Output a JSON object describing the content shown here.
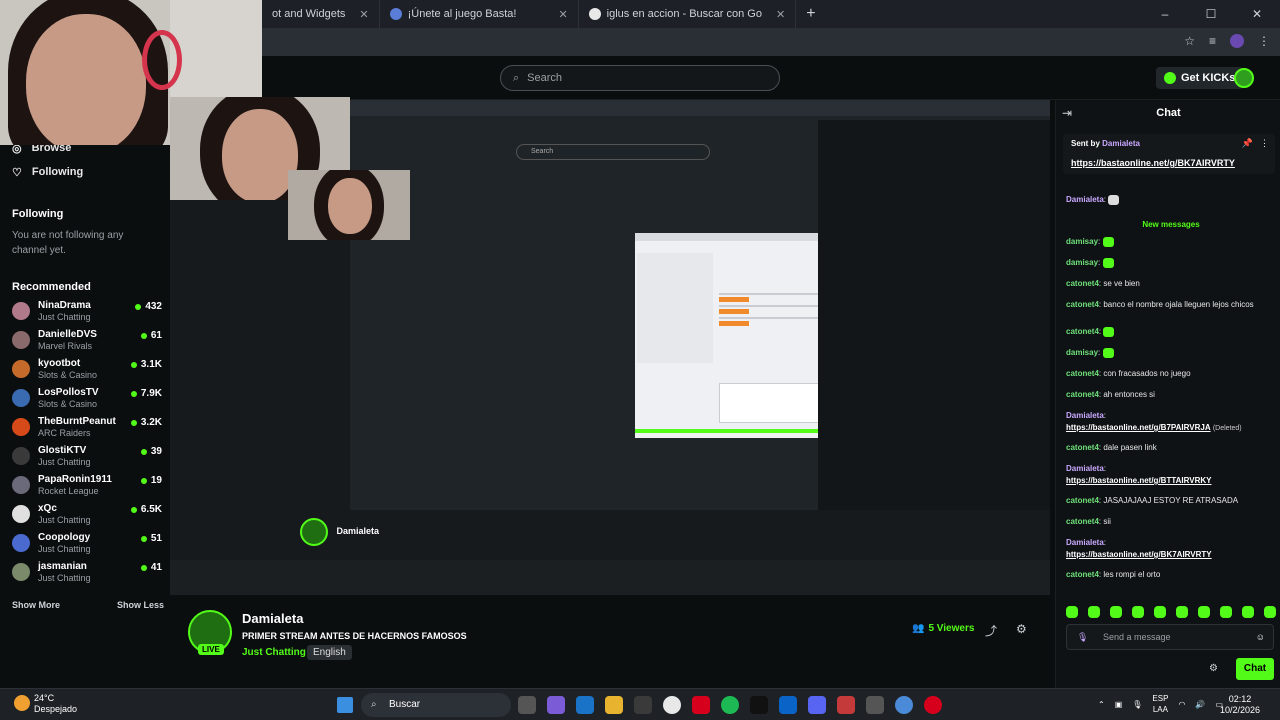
{
  "browser": {
    "tabs": [
      {
        "label": "ot and Widgets"
      },
      {
        "label": "¡Únete al juego Basta!"
      },
      {
        "label": "iglus en accion - Buscar con Go"
      }
    ],
    "new_tab": "+",
    "window_buttons": [
      "–",
      "☐",
      "✕"
    ]
  },
  "header": {
    "search_placeholder": "Search",
    "get_kicks_label": "Get KICKs"
  },
  "sidebar": {
    "browse_label": "Browse",
    "following_nav": "Following",
    "following_heading": "Following",
    "following_note": "You are not following any channel yet.",
    "recommended_heading": "Recommended",
    "channels": [
      {
        "name": "NinaDrama",
        "category": "Just Chatting",
        "viewers": "432",
        "color": "#b07a8a"
      },
      {
        "name": "DanielleDVS",
        "category": "Marvel Rivals",
        "viewers": "61",
        "color": "#8a6a6a"
      },
      {
        "name": "kyootbot",
        "category": "Slots & Casino",
        "viewers": "3.1K",
        "color": "#c46a2a"
      },
      {
        "name": "LosPollosTV",
        "category": "Slots & Casino",
        "viewers": "7.9K",
        "color": "#3a6ab0"
      },
      {
        "name": "TheBurntPeanut",
        "category": "ARC Raiders",
        "viewers": "3.2K",
        "color": "#d64a1a"
      },
      {
        "name": "GlostiKTV",
        "category": "Just Chatting",
        "viewers": "39",
        "color": "#3a3a3a"
      },
      {
        "name": "PapaRonin1911",
        "category": "Rocket League",
        "viewers": "19",
        "color": "#6a6a7a"
      },
      {
        "name": "xQc",
        "category": "Just Chatting",
        "viewers": "6.5K",
        "color": "#e0e0e0"
      },
      {
        "name": "Coopology",
        "category": "Just Chatting",
        "viewers": "51",
        "color": "#4a6ad0"
      },
      {
        "name": "jasmanian",
        "category": "Just Chatting",
        "viewers": "41",
        "color": "#7a8a6a"
      }
    ],
    "show_more": "Show More",
    "show_less": "Show Less"
  },
  "stream": {
    "channel_name": "Damialeta",
    "title": "PRIMER STREAM ANTES DE HACERNOS FAMOSOS",
    "category": "Just Chatting",
    "language": "English",
    "live_badge": "LIVE",
    "viewers": "5 Viewers"
  },
  "chat": {
    "heading": "Chat",
    "pinned": {
      "sent_by_prefix": "Sent by",
      "sender": "Damialeta",
      "link": "https://bastaonline.net/g/BK7AIRVRTY"
    },
    "first_line": {
      "user": "Damialeta",
      "text": ":"
    },
    "new_messages_label": "New messages",
    "messages": [
      {
        "user": "damisay",
        "text": ":",
        "type": "emote"
      },
      {
        "user": "damisay",
        "text": ":",
        "type": "emote"
      },
      {
        "user": "catonet4",
        "text": ": se ve bien",
        "type": "text"
      },
      {
        "user": "catonet4",
        "text": ": banco el nombre ojala lleguen lejos chicos",
        "type": "text"
      },
      {
        "user": "catonet4",
        "text": ":",
        "type": "emote"
      },
      {
        "user": "damisay",
        "text": ":",
        "type": "emote"
      },
      {
        "user": "catonet4",
        "text": ": con fracasados no juego",
        "type": "text"
      },
      {
        "user": "catonet4",
        "text": ": ah entonces si",
        "type": "text"
      },
      {
        "user": "Damialeta",
        "text": ":",
        "link": "https://bastaonline.net/g/B7PAIRVRJA",
        "suffix": "(Deleted)",
        "type": "link"
      },
      {
        "user": "catonet4",
        "text": ": dale pasen link",
        "type": "text"
      },
      {
        "user": "Damialeta",
        "text": ":",
        "link": "https://bastaonline.net/g/BTTAIRVRKY",
        "suffix": "",
        "type": "link"
      },
      {
        "user": "catonet4",
        "text": ": JASAJAJAAJ ESTOY RE ATRASADA",
        "type": "text"
      },
      {
        "user": "catonet4",
        "text": ": sii",
        "type": "text"
      },
      {
        "user": "Damialeta",
        "text": ":",
        "link": "https://bastaonline.net/g/BK7AIRVRTY",
        "suffix": "",
        "type": "link"
      },
      {
        "user": "catonet4",
        "text": ": les rompi el orto",
        "type": "text"
      }
    ],
    "send_placeholder": "Send a message",
    "chat_button": "Chat"
  },
  "taskbar": {
    "weather_temp": "24°C",
    "weather_desc": "Despejado",
    "search_label": "Buscar",
    "lang_top": "ESP",
    "lang_bottom": "LAA",
    "time": "02:12",
    "date": "10/2/2026"
  }
}
